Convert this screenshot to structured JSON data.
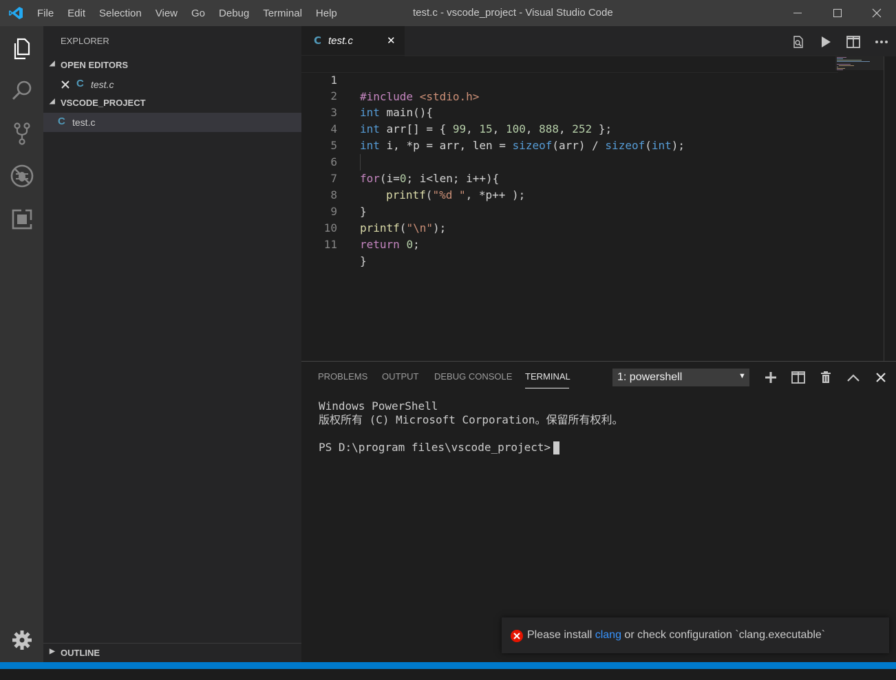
{
  "titlebar": {
    "menu": [
      "File",
      "Edit",
      "Selection",
      "View",
      "Go",
      "Debug",
      "Terminal",
      "Help"
    ],
    "title": "test.c - vscode_project - Visual Studio Code"
  },
  "activity_bar": {
    "icons": [
      "explorer-icon",
      "search-icon",
      "source-control-icon",
      "debug-icon",
      "extensions-icon",
      "gear-icon"
    ]
  },
  "sidebar": {
    "title": "EXPLORER",
    "open_editors": {
      "label": "OPEN EDITORS",
      "files": [
        {
          "name": "test.c"
        }
      ]
    },
    "project": {
      "label": "VSCODE_PROJECT",
      "files": [
        {
          "name": "test.c"
        }
      ]
    },
    "outline_label": "OUTLINE"
  },
  "editor": {
    "tab_label": "test.c",
    "lines": [
      {
        "num": "1"
      },
      {
        "num": "2"
      },
      {
        "num": "3"
      },
      {
        "num": "4"
      },
      {
        "num": "5"
      },
      {
        "num": "6"
      },
      {
        "num": "7"
      },
      {
        "num": "8"
      },
      {
        "num": "9"
      },
      {
        "num": "10"
      },
      {
        "num": "11"
      }
    ],
    "code": {
      "l1": {
        "directive": "#include",
        "header": "<stdio.h>"
      },
      "l2": {
        "type": "int",
        "rest": " main(){"
      },
      "l3": {
        "type": "int",
        "decl": " arr[] = { ",
        "n1": "99",
        "sep1": ", ",
        "n2": "15",
        "sep2": ", ",
        "n3": "100",
        "sep3": ", ",
        "n4": "888",
        "sep4": ", ",
        "n5": "252",
        "tail": " };"
      },
      "l4": {
        "type": "int",
        "decl": " i, *p = arr, len = ",
        "sizeof1": "sizeof",
        "arg1": "(arr) / ",
        "sizeof2": "sizeof",
        "paren_open": "(",
        "type2": "int",
        "tail": ");"
      },
      "l6": {
        "kw": "for",
        "a": "(i=",
        "n": "0",
        "b": "; i<len; i++){"
      },
      "l7": {
        "fn": "printf",
        "open": "(",
        "str": "\"%d \"",
        "rest": ", *p++ );"
      },
      "l8": {
        "text": "}"
      },
      "l9": {
        "fn": "printf",
        "open": "(",
        "str": "\"\\n\"",
        "tail": ");"
      },
      "l10": {
        "kw": "return",
        "sp": " ",
        "n": "0",
        "tail": ";"
      },
      "l11": {
        "text": "}"
      }
    }
  },
  "panel": {
    "tabs": [
      "PROBLEMS",
      "OUTPUT",
      "DEBUG CONSOLE",
      "TERMINAL"
    ],
    "active_tab": "TERMINAL",
    "terminal_select": "1: powershell",
    "terminal_lines": [
      "Windows PowerShell",
      "版权所有 (C) Microsoft Corporation。保留所有权利。",
      "",
      "PS D:\\program files\\vscode_project>"
    ]
  },
  "notification": {
    "prefix": "Please install ",
    "link": "clang",
    "suffix": " or check configuration `clang.executable`"
  },
  "colors": {
    "accent": "#007acc",
    "keyword": "#569cd6",
    "control": "#c586c0",
    "function": "#dcdcaa",
    "string": "#ce9178",
    "number": "#b5cea8",
    "error": "#e51400"
  }
}
